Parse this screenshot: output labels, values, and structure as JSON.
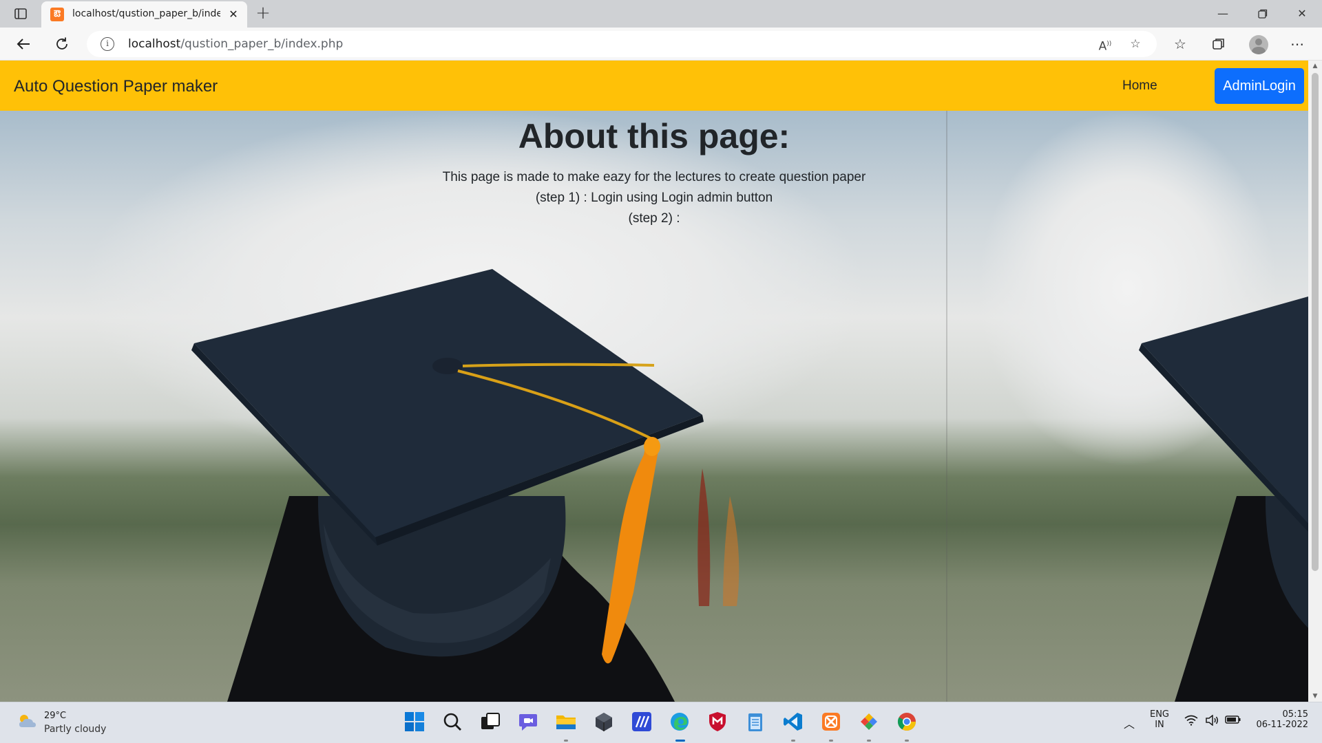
{
  "browser": {
    "tab_title": "localhost/qustion_paper_b/index.php",
    "tab_favicon_glyph": "ఔ",
    "url_host": "localhost",
    "url_path": "/qustion_paper_b/index.php",
    "icons": [
      "tab-actions-icon",
      "back-icon",
      "refresh-icon",
      "info-icon",
      "read-aloud-icon",
      "favorite-add-icon",
      "favorites-icon",
      "collections-icon",
      "profile-avatar",
      "more-icon",
      "minimize-icon",
      "restore-icon",
      "close-icon"
    ]
  },
  "page": {
    "brand": "Auto Question Paper maker",
    "nav_home": "Home",
    "admin_login": "AdminLogin",
    "about_title": "About this page:",
    "about_lines": [
      "This page is made to make eazy for the lectures to create question paper",
      "(step 1) : Login using Login admin button",
      "(step 2) :"
    ],
    "navbar_color": "#ffc107",
    "button_color": "#0d6efd"
  },
  "taskbar": {
    "weather_temp": "29°C",
    "weather_desc": "Partly cloudy",
    "lang_line1": "ENG",
    "lang_line2": "IN",
    "time": "05:15",
    "date": "06-11-2022",
    "apps": [
      "start-icon",
      "search-icon",
      "task-view-icon",
      "chat-icon",
      "file-explorer-icon",
      "app-cube-icon",
      "app-mi-icon",
      "edge-icon",
      "mcafee-icon",
      "notepad-icon",
      "vscode-icon",
      "xampp-icon",
      "app-diamond-icon",
      "chrome-icon"
    ]
  }
}
